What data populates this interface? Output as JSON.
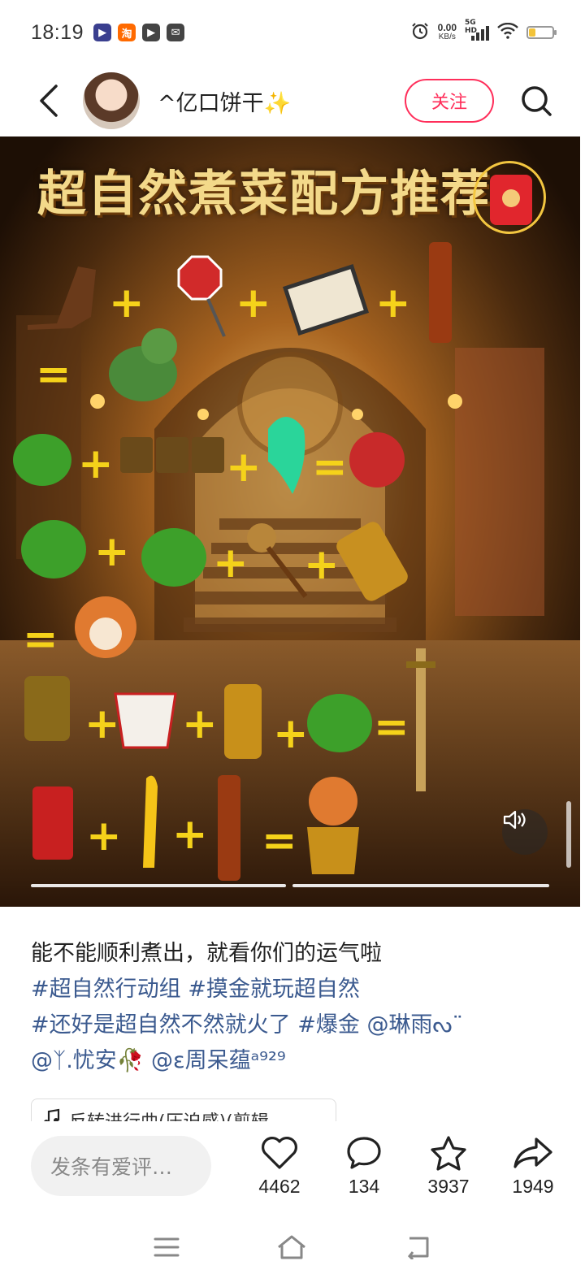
{
  "status_bar": {
    "time": "18:19",
    "net_speed": "0.00",
    "net_unit": "KB/s",
    "signal_label": "5G HD",
    "battery_level": 0.3,
    "app_icons": [
      {
        "name": "video-app-icon",
        "glyph": "▶",
        "color": "#3a3f8f"
      },
      {
        "name": "taobao-app-icon",
        "glyph": "淘",
        "color": "#ff6a00"
      },
      {
        "name": "player-app-icon",
        "glyph": "▶",
        "color": "#444444"
      },
      {
        "name": "mail-app-icon",
        "glyph": "✉",
        "color": "#444444"
      }
    ]
  },
  "header": {
    "username": "^亿口饼干✨",
    "follow_label": "关注"
  },
  "image": {
    "title": "超自然煮菜配方推荐",
    "colors": {
      "title": "#f3d98a",
      "plus": "#f5d21a",
      "accent_green": "#3da02a"
    }
  },
  "post": {
    "caption": "能不能顺利煮出，就看你们的运气啦",
    "line2": [
      "#超自然行动组",
      "#摸金就玩超自然"
    ],
    "line3_tags": [
      "#还好是超自然不然就火了",
      "#爆金"
    ],
    "line3_mention": "@琳雨ᔓ¨",
    "line4_mentions": [
      "@ᛉ.忧安🥀",
      "@ε周呆蕴ᵃ⁹²⁹"
    ],
    "music": "反转进行曲(压迫感)(剪辑…"
  },
  "bottom": {
    "comment_placeholder": "发条有爱评…",
    "likes": "4462",
    "comments": "134",
    "favorites": "3937",
    "shares": "1949"
  }
}
